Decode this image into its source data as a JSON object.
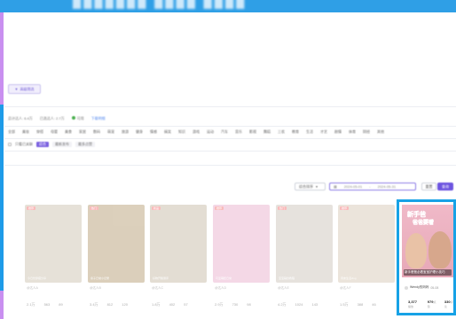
{
  "banner": {
    "title": "███████ ████ ████"
  },
  "filter_button": {
    "label": "高级筛选"
  },
  "stats": {
    "total": "总计达人: 6.4万",
    "selected": "已选达人: 2.7万",
    "status": "可用",
    "link": "下载明细"
  },
  "tabs": [
    "全部",
    "美妆",
    "穿搭",
    "母婴",
    "美食",
    "家居",
    "数码",
    "萌宠",
    "旅游",
    "健身",
    "情感",
    "搞笑",
    "知识",
    "游戏",
    "运动",
    "汽车",
    "音乐",
    "影视",
    "舞蹈",
    "三农",
    "教育",
    "生活",
    "才艺",
    "剧情",
    "体育",
    "财经",
    "其他"
  ],
  "subtabs": {
    "checkbox_label": "只看已关联",
    "items": [
      "综合",
      "最新发布",
      "最多点赞"
    ]
  },
  "toolbar": {
    "sort": "综合排序",
    "date_from": "2024-05-01",
    "date_to": "2024-05-31",
    "reset": "重置",
    "confirm": "查询"
  },
  "cards": [
    {
      "tag": "推荐",
      "caption": "今日份穿搭分享",
      "author": "@达人A",
      "plays": "2.1万",
      "likes": "563",
      "comments": "89",
      "bg": "#cfc5b3"
    },
    {
      "tag": "热门",
      "caption": "亲子日常小记录",
      "author": "@达人B",
      "plays": "3.4万",
      "likes": "812",
      "comments": "120",
      "bg": "#b9a17a"
    },
    {
      "tag": "新品",
      "caption": "好物开箱测评",
      "author": "@达人C",
      "plays": "1.8万",
      "likes": "402",
      "comments": "57",
      "bg": "#c9bca9"
    },
    {
      "tag": "推荐",
      "caption": "可爱萌娃日常",
      "author": "@达人D",
      "plays": "2.9万",
      "likes": "730",
      "comments": "98",
      "bg": "#eab3cf"
    },
    {
      "tag": "热门",
      "caption": "宝宝辅食教程",
      "author": "@达人E",
      "plays": "4.2万",
      "likes": "1024",
      "comments": "143",
      "bg": "#cfc6bd"
    },
    {
      "tag": "推荐",
      "caption": "周末生活vlog",
      "author": "@达人F",
      "plays": "1.5万",
      "likes": "388",
      "comments": "46",
      "bg": "#d9cbb8"
    }
  ],
  "featured": {
    "headline1": "新手爸",
    "headline2": "爸爸要看",
    "caption": "新手爸爸必看宝宝护理小技巧",
    "author": "Wendy的妈妈",
    "date": "05-08",
    "plays": "3,377",
    "likes": "979",
    "comments": "330",
    "plays_label": "播放",
    "likes_label": "点赞",
    "comments_label": "评论"
  },
  "colors": {
    "accent": "#6d55e0",
    "banner": "#2f9fe6",
    "highlight": "#17a2e6"
  }
}
